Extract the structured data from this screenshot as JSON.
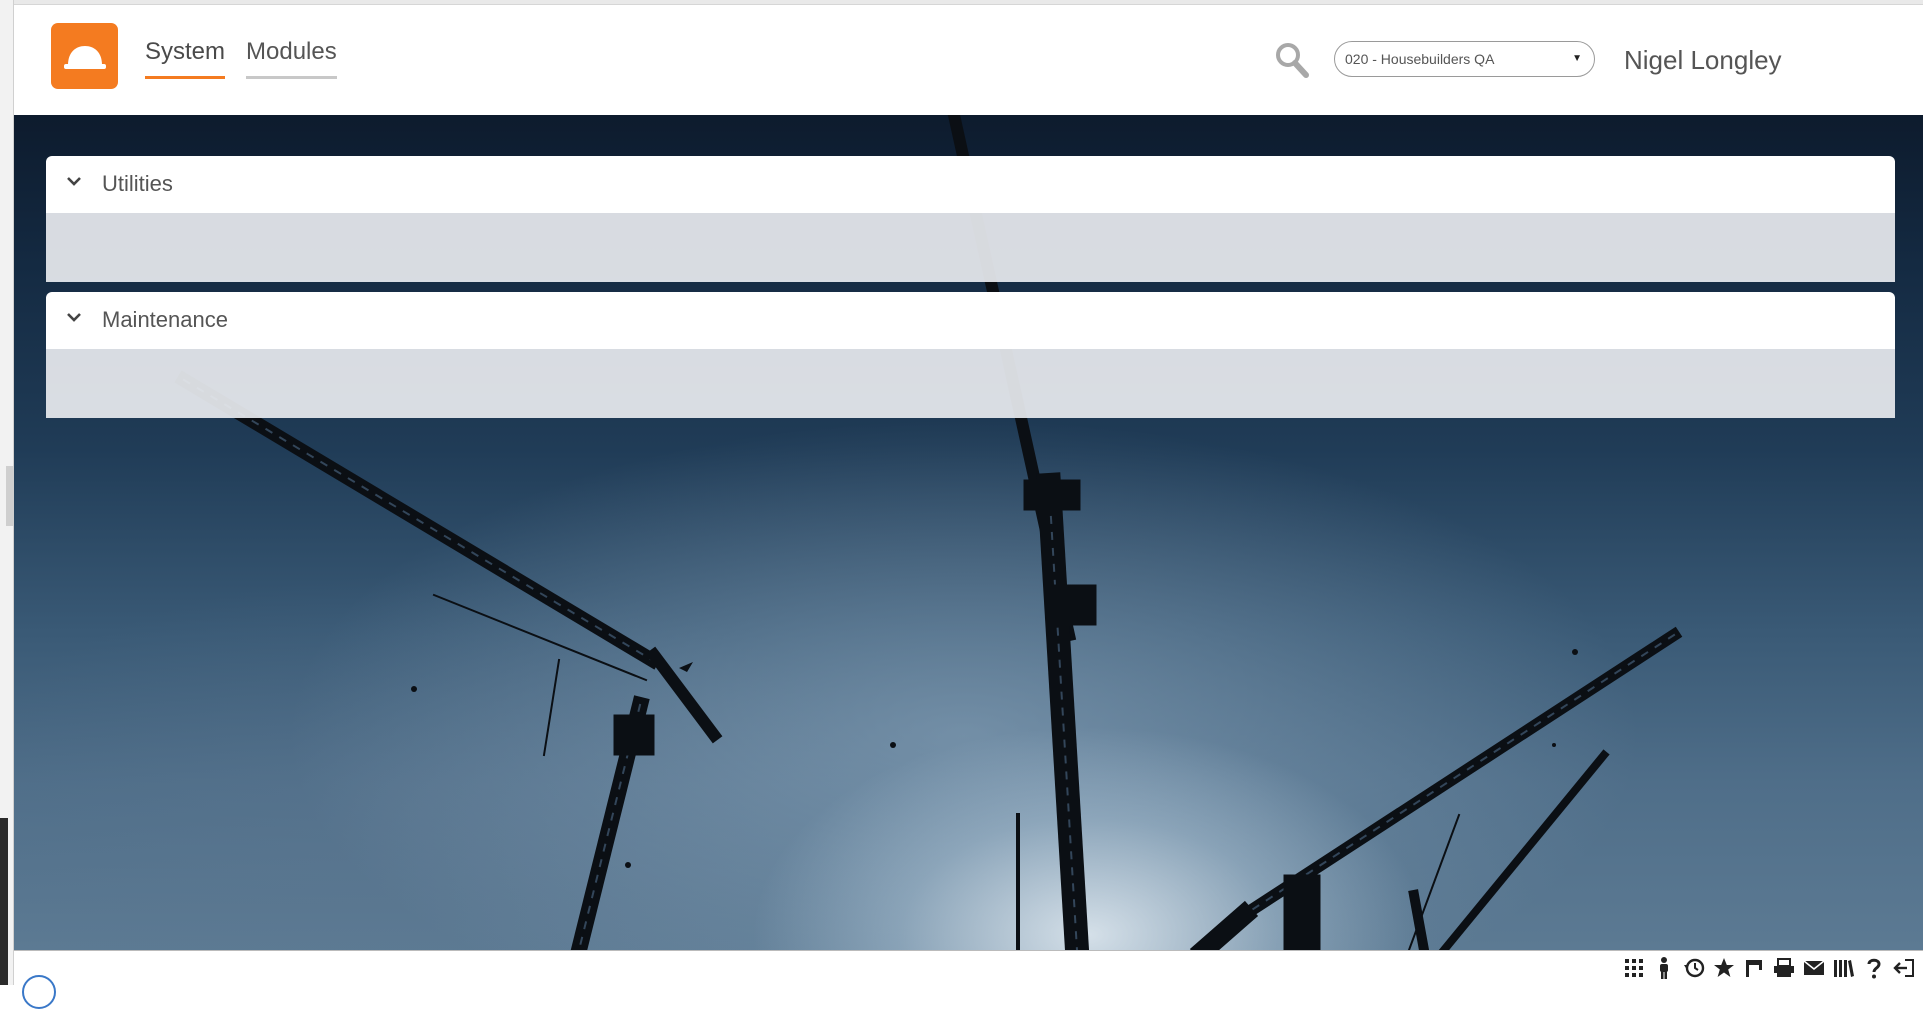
{
  "app": {
    "logo_icon": "hard-hat-icon",
    "brand_color": "#f47b20"
  },
  "nav": {
    "tabs": [
      {
        "label": "System",
        "active": true
      },
      {
        "label": "Modules",
        "active": false
      }
    ]
  },
  "header": {
    "search_icon": "search-icon",
    "company_select": {
      "value": "020 - Housebuilders QA"
    },
    "user_name": "Nigel Longley"
  },
  "panels": [
    {
      "title": "Utilities",
      "icon": "chevron-down-icon"
    },
    {
      "title": "Maintenance",
      "icon": "chevron-down-icon"
    }
  ],
  "footer": {
    "icons": [
      "grid-icon",
      "person-icon",
      "history-icon",
      "star-icon",
      "flag-icon",
      "printer-icon",
      "mail-icon",
      "library-icon",
      "help-icon",
      "logout-icon"
    ]
  }
}
